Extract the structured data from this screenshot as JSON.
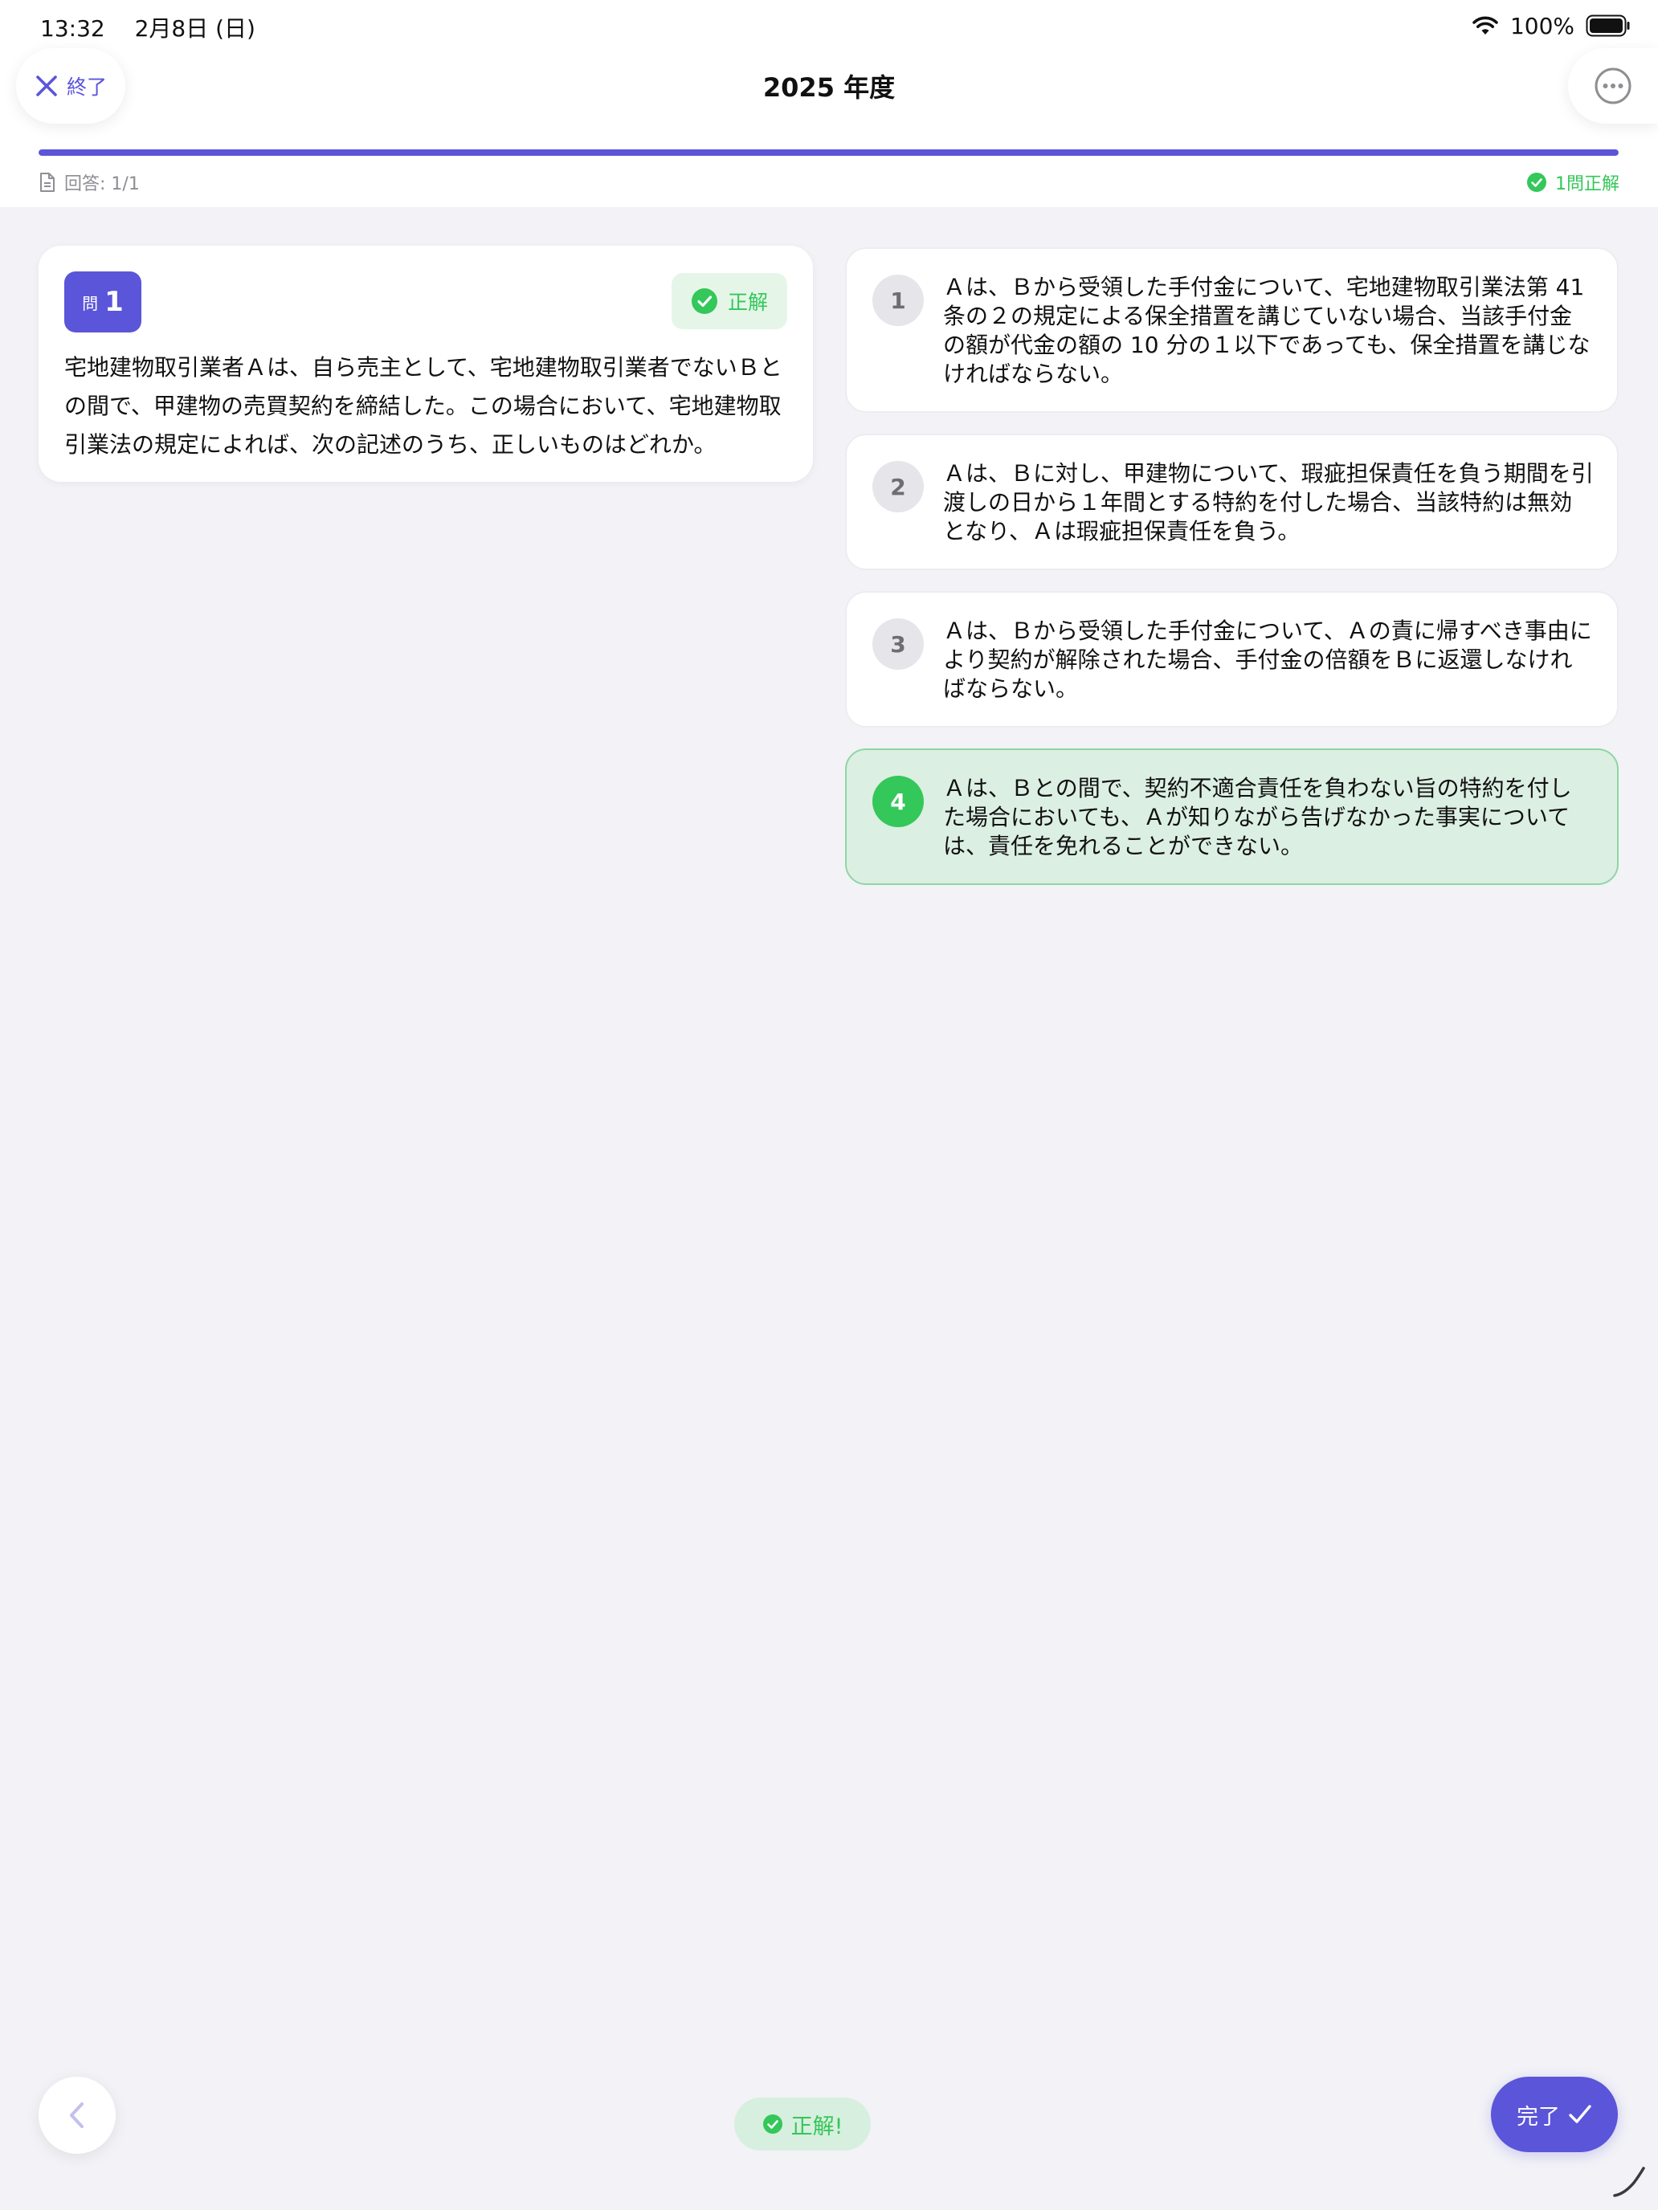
{
  "status_bar": {
    "time_date": "13:32　 2月8日 (日)",
    "battery": "100%"
  },
  "header": {
    "quit_label": "終了",
    "title": "2025 年度"
  },
  "progress": {
    "fraction": 1.0,
    "answered_label": "回答: 1/1",
    "correct_label": "1問正解"
  },
  "question": {
    "prefix": "問",
    "number": "1",
    "result_label": "正解",
    "text": "宅地建物取引業者Ａは、自ら売主として、宅地建物取引業者でないＢとの間で、甲建物の売買契約を締結した。この場合において、宅地建物取引業法の規定によれば、次の記述のうち、正しいものはどれか。"
  },
  "choices": [
    {
      "num": "1",
      "text": "Ａは、Ｂから受領した手付金について、宅地建物取引業法第 41 条の２の規定による保全措置を講じていない場合、当該手付金の額が代金の額の 10 分の１以下であっても、保全措置を講じなければならない。"
    },
    {
      "num": "2",
      "text": "Ａは、Ｂに対し、甲建物について、瑕疵担保責任を負う期間を引渡しの日から１年間とする特約を付した場合、当該特約は無効となり、Ａは瑕疵担保責任を負う。"
    },
    {
      "num": "3",
      "text": "Ａは、Ｂから受領した手付金について、Ａの責に帰すべき事由により契約が解除された場合、手付金の倍額をＢに返還しなければならない。"
    },
    {
      "num": "4",
      "text": "Ａは、Ｂとの間で、契約不適合責任を負わない旨の特約を付した場合においても、Ａが知りながら告げなかった事実については、責任を免れることができない。"
    }
  ],
  "footer": {
    "toast_label": "正解!",
    "done_label": "完了"
  },
  "colors": {
    "accent": "#5b55d9",
    "success": "#34c759",
    "selected_bg": "#dcefe3",
    "background": "#f2f2f7"
  },
  "icons": [
    "wifi-icon",
    "battery-icon",
    "close-icon",
    "ellipsis-icon",
    "document-icon",
    "check-circle-icon",
    "chevron-left-icon",
    "checkmark-icon"
  ]
}
